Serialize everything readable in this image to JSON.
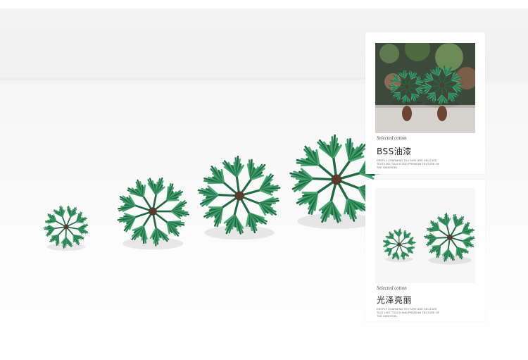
{
  "card_top": {
    "caption": "Selected cotton",
    "heading": "BSS油漆",
    "fineprint": "DEEPLY CHARMING TEXTURE AND DELICATE TEXT LIKE TOUCH AND PREMIUM TEXTURE OF THE HANDFEEL"
  },
  "card_bottom": {
    "caption": "Selected cotton",
    "heading": "光泽亮丽",
    "fineprint": "DEEPLY CHARMING TEXTURE AND DELICATE TEXT LIKE TOUCH AND PREMIUM TEXTURE OF THE HANDFEEL"
  },
  "colors": {
    "leaf_dark": "#1f6a45",
    "leaf_mid": "#2f8a5a",
    "leaf_light": "#4aa872",
    "trunk": "#5a3a2a"
  }
}
